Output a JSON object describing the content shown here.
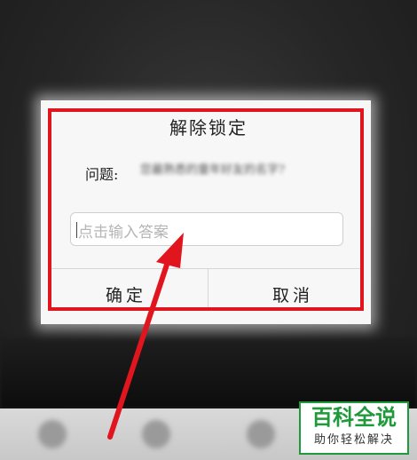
{
  "dialog": {
    "title": "解除锁定",
    "question_label": "问题:",
    "question_text": "您最熟悉的童年好友的名字?",
    "answer_placeholder": "点击输入答案",
    "confirm_label": "确定",
    "cancel_label": "取消"
  },
  "watermark": {
    "brand": "百科全说",
    "tagline": "助你轻松解决"
  },
  "colors": {
    "highlight": "#e1151d",
    "brand": "#1e9a3a"
  }
}
